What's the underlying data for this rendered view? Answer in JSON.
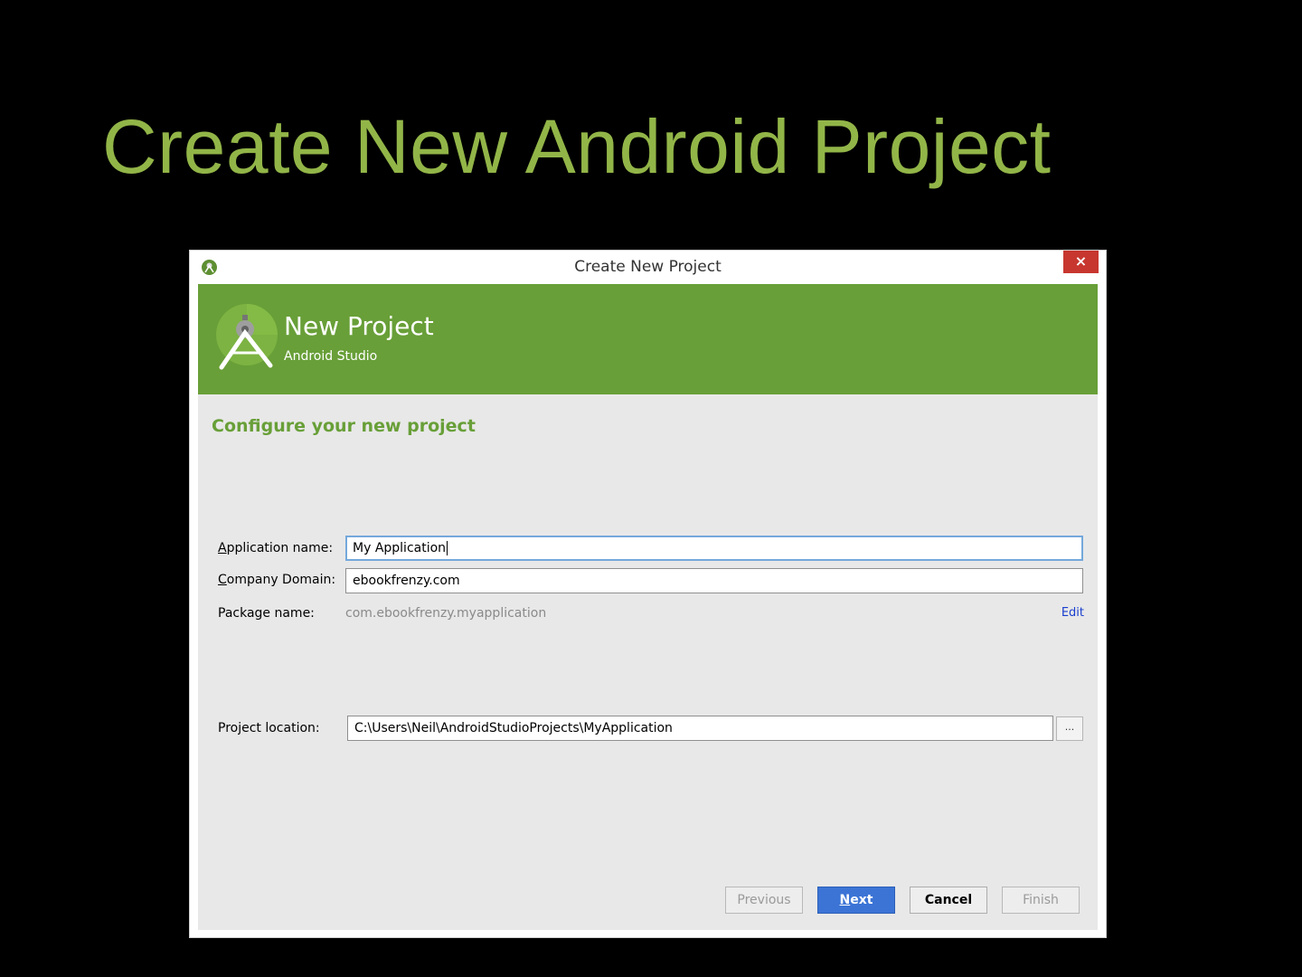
{
  "slide": {
    "title": "Create New Android Project"
  },
  "window": {
    "title": "Create New Project",
    "close_glyph": "×"
  },
  "banner": {
    "title": "New Project",
    "subtitle": "Android Studio"
  },
  "form": {
    "heading": "Configure your new project",
    "app_name": {
      "label_mnemonic": "A",
      "label_rest": "pplication name:",
      "value": "My Application"
    },
    "company_domain": {
      "label_mnemonic": "C",
      "label_rest": "ompany Domain:",
      "value": "ebookfrenzy.com"
    },
    "package_name": {
      "label": "Package name:",
      "value": "com.ebookfrenzy.myapplication",
      "edit_label": "Edit"
    },
    "project_location": {
      "label": "Project location:",
      "value": "C:\\Users\\Neil\\AndroidStudioProjects\\MyApplication",
      "browse_label": "..."
    }
  },
  "buttons": {
    "previous": "Previous",
    "next_mnemonic": "N",
    "next_rest": "ext",
    "cancel": "Cancel",
    "finish": "Finish"
  },
  "colors": {
    "slide_title": "#92b548",
    "banner": "#689f38",
    "heading": "#689f38",
    "close": "#c7372f",
    "primary_button": "#3c74d6",
    "link": "#1a3fcf"
  },
  "icons": {
    "app": "android-studio-icon",
    "banner": "android-studio-logo-icon"
  }
}
